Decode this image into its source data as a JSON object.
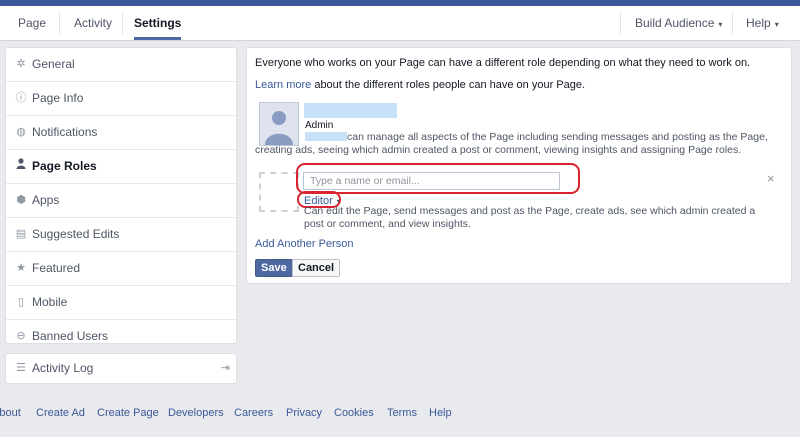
{
  "nav": {
    "tabs": [
      {
        "label": "Page"
      },
      {
        "label": "Activity"
      },
      {
        "label": "Settings"
      }
    ],
    "build_audience": "Build Audience",
    "help": "Help",
    "caret": "▾"
  },
  "sidebar": {
    "items": [
      {
        "label": "General",
        "icon": "gear-icon"
      },
      {
        "label": "Page Info",
        "icon": "info-icon"
      },
      {
        "label": "Notifications",
        "icon": "globe-icon"
      },
      {
        "label": "Page Roles",
        "icon": "person-icon"
      },
      {
        "label": "Apps",
        "icon": "cube-icon"
      },
      {
        "label": "Suggested Edits",
        "icon": "edits-icon"
      },
      {
        "label": "Featured",
        "icon": "star-icon"
      },
      {
        "label": "Mobile",
        "icon": "mobile-icon"
      },
      {
        "label": "Banned Users",
        "icon": "ban-icon"
      }
    ],
    "active": "Page Roles",
    "activity_log": "Activity Log"
  },
  "main": {
    "intro": "Everyone who works on your Page can have a different role depending on what they need to work on.",
    "learn_more_link": "Learn more",
    "learn_more_rest": " about the different roles people can have on your Page.",
    "admin_role": "Admin",
    "admin_desc": "can manage all aspects of the Page including sending messages and posting as the Page, creating ads, seeing which admin created a post or comment, viewing insights and assigning Page roles.",
    "input_placeholder": "Type a name or email...",
    "editor_label": "Editor",
    "editor_desc": "Can edit the Page, send messages and post as the Page, create ads, see which admin created a post or comment, and view insights.",
    "add_another": "Add Another Person",
    "save": "Save",
    "cancel": "Cancel",
    "close": "×"
  },
  "footer": {
    "links": [
      "About",
      "Create Ad",
      "Create Page",
      "Developers",
      "Careers",
      "Privacy",
      "Cookies",
      "Terms",
      "Help"
    ]
  },
  "colors": {
    "brand": "#3b5998",
    "highlight": "#d9232e",
    "redaction": "#c6e1f8"
  }
}
